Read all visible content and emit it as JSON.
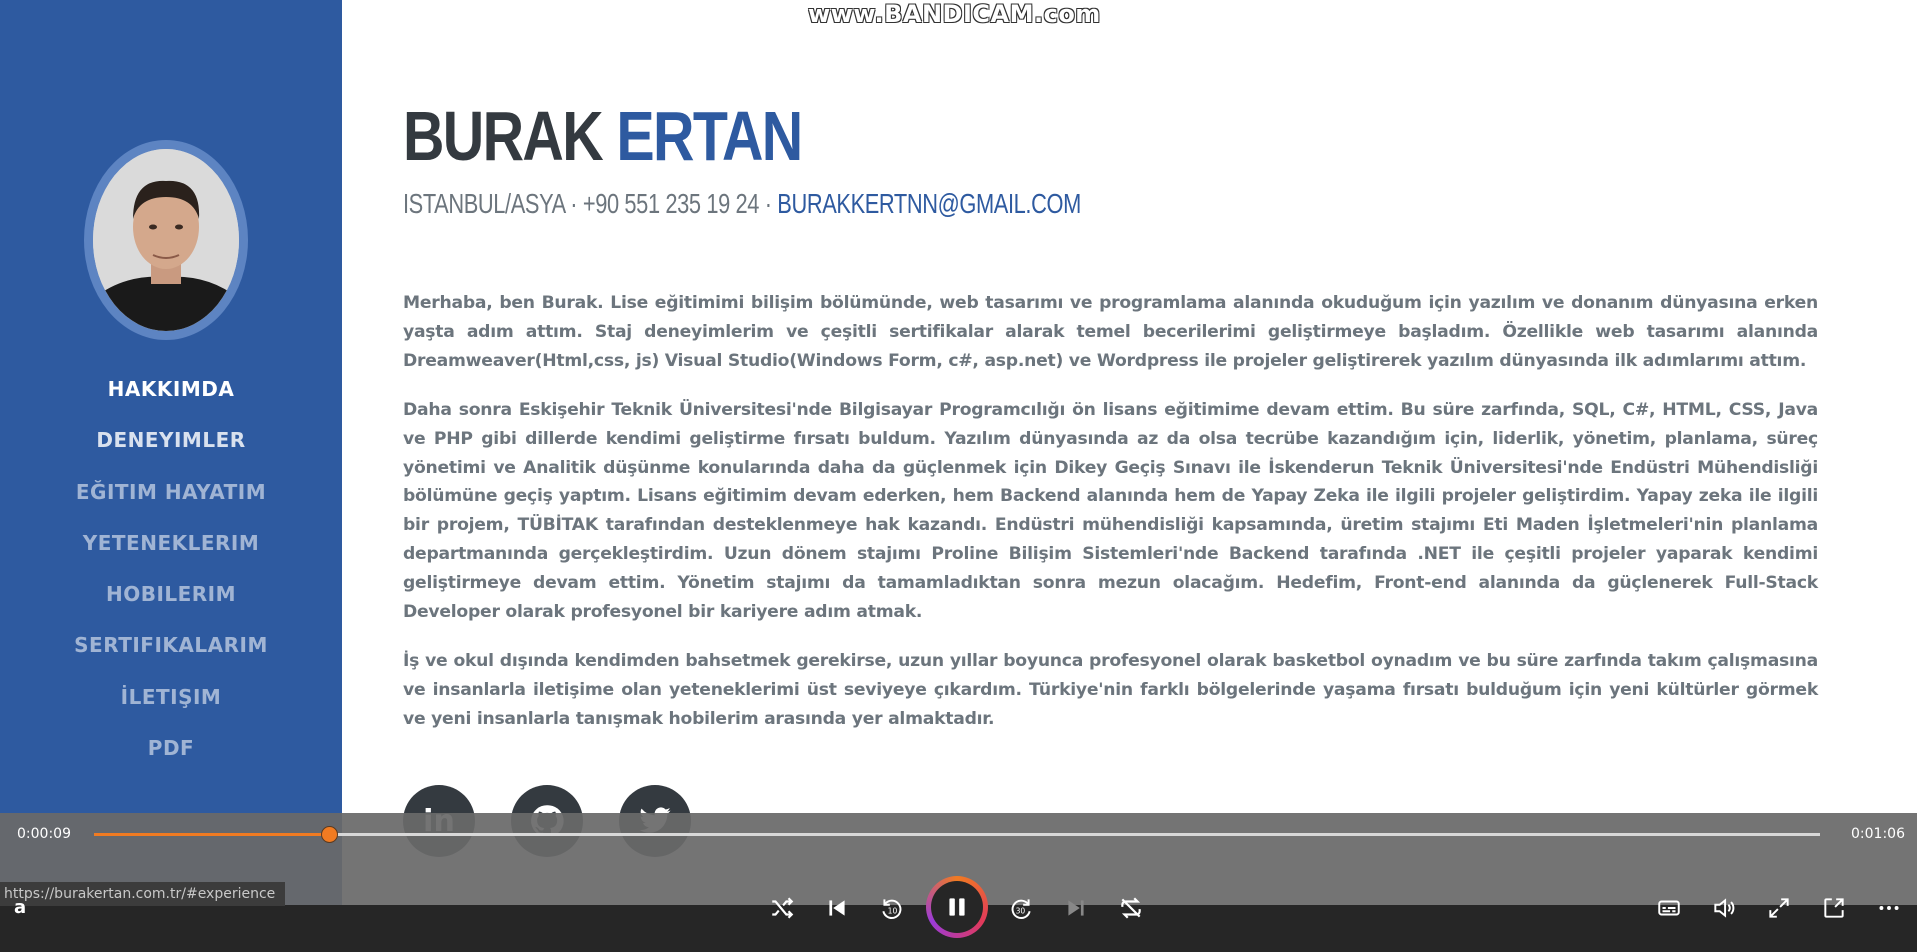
{
  "watermark": "www.BANDICAM.com",
  "profile": {
    "first_name": "BURAK",
    "last_name": "ERTAN",
    "location": "ISTANBUL/ASYA",
    "phone": "+90 551 235 19 24",
    "email": "BURAKKERTNN@GMAIL.COM",
    "separator": "·"
  },
  "nav": {
    "items": [
      {
        "label": "HAKKIMDA"
      },
      {
        "label": "DENEYIMLER"
      },
      {
        "label": "EĞITIM HAYATIM"
      },
      {
        "label": "YETENEKLERIM"
      },
      {
        "label": "HOBILERIM"
      },
      {
        "label": "SERTIFIKALARIM"
      },
      {
        "label": "İLETIŞIM"
      },
      {
        "label": "PDF"
      }
    ]
  },
  "about": {
    "paragraphs": [
      "Merhaba, ben Burak. Lise eğitimimi bilişim bölümünde, web tasarımı ve programlama alanında okuduğum için yazılım ve donanım dünyasına erken yaşta adım attım. Staj deneyimlerim ve çeşitli sertifikalar alarak temel becerilerimi geliştirmeye başladım. Özellikle web tasarımı alanında Dreamweaver(Html,css, js) Visual Studio(Windows Form, c#, asp.net) ve Wordpress ile projeler geliştirerek yazılım dünyasında ilk adımlarımı attım.",
      "Daha sonra Eskişehir Teknik Üniversitesi'nde Bilgisayar Programcılığı ön lisans eğitimime devam ettim. Bu süre zarfında, SQL, C#, HTML, CSS, Java ve PHP gibi dillerde kendimi geliştirme fırsatı buldum. Yazılım dünyasında az da olsa tecrübe kazandığım için, liderlik, yönetim, planlama, süreç yönetimi ve Analitik düşünme konularında daha da güçlenmek için Dikey Geçiş Sınavı ile İskenderun Teknik Üniversitesi'nde Endüstri Mühendisliği bölümüne geçiş yaptım. Lisans eğitimim devam ederken, hem Backend alanında hem de Yapay Zeka ile ilgili projeler geliştirdim. Yapay zeka ile ilgili bir projem, TÜBİTAK tarafından desteklenmeye hak kazandı. Endüstri mühendisliği kapsamında, üretim stajımı Eti Maden İşletmeleri'nin planlama departmanında gerçekleştirdim. Uzun dönem stajımı Proline Bilişim Sistemleri'nde Backend tarafında .NET ile çeşitli projeler yaparak kendimi geliştirmeye devam ettim. Yönetim stajımı da tamamladıktan sonra mezun olacağım. Hedefim, Front-end alanında da güçlenerek Full-Stack Developer olarak profesyonel bir kariyere adım atmak.",
      "İş ve okul dışında kendimden bahsetmek gerekirse, uzun yıllar boyunca profesyonel olarak basketbol oynadım ve bu süre zarfında takım çalışmasına ve insanlarla iletişime olan yeteneklerimi üst seviyeye çıkardım. Türkiye'nin farklı bölgelerinde yaşama fırsatı bulduğum için yeni kültürler görmek ve yeni insanlarla tanışmak hobilerim arasında yer almaktadır."
    ]
  },
  "social": {
    "linkedin_label": "in",
    "icons": [
      "linkedin-icon",
      "github-icon",
      "twitter-icon"
    ]
  },
  "player": {
    "current_time": "0:00:09",
    "total_time": "0:01:06",
    "progress": 0.136,
    "url_tooltip": "https://burakertan.com.tr/#experience",
    "key_hint": "a",
    "accent": "#f07b22"
  },
  "colors": {
    "sidebar": "#2e5aa0",
    "accent": "#2e5aa0",
    "text": "#6c757d",
    "heading": "#343a40"
  }
}
